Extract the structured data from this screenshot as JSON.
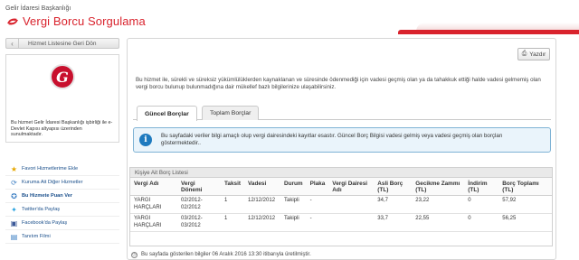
{
  "header": {
    "org_name": "Gelir İdaresi Başkanlığı",
    "app_title": "Vergi Borcu Sorgulama"
  },
  "sidebar": {
    "back_label": "Hizmet Listesine Geri Dön",
    "info_text": "Bu hizmet Gelir İdaresi Başkanlığı işbirliği ile e-Devlet Kapısı altyapısı üzerinden sunulmaktadır.",
    "links": [
      {
        "label": "Favori Hizmetlerime Ekle",
        "icon": "star-icon"
      },
      {
        "label": "Kuruma Ait Diğer Hizmetler",
        "icon": "refresh-icon"
      },
      {
        "label": "Bu Hizmete Puan Ver",
        "icon": "rating-icon"
      },
      {
        "label": "Twitter'da Paylaş",
        "icon": "twitter-icon"
      },
      {
        "label": "Facebook'da Paylaş",
        "icon": "facebook-icon"
      },
      {
        "label": "Tanıtım Filmi",
        "icon": "film-icon"
      }
    ]
  },
  "main": {
    "print_label": "Yazdır",
    "description": "Bu hizmet ile, sürekli ve süreksiz yükümlülüklerden kaynaklanan ve süresinde ödenmediği için vadesi geçmiş olan ya da tahakkuk ettiği halde vadesi gelmemiş olan vergi borcu bulunup bulunmadığına dair mükellef bazlı bilgilerinize ulaşabilirsiniz.",
    "tabs": [
      {
        "label": "Güncel Borçlar",
        "active": true
      },
      {
        "label": "Toplam Borçlar",
        "active": false
      }
    ],
    "alert": "Bu sayfadaki veriler bilgi amaçlı olup vergi dairesindeki kayıtlar esastır. Güncel Borç Bilgisi vadesi gelmiş veya vadesi geçmiş olan borçları göstermektedir..",
    "list_title": "Kişiye Ait Borç Listesi",
    "columns": [
      "Vergi Adı",
      "Vergi Dönemi",
      "Taksit",
      "Vadesi",
      "Durum",
      "Plaka",
      "Vergi Dairesi Adı",
      "Asli Borç (TL)",
      "Gecikme Zammı (TL)",
      "İndirim (TL)",
      "Borç Toplamı (TL)"
    ],
    "rows": [
      [
        "YARGI HARÇLARI",
        "02/2012-02/2012",
        "1",
        "12/12/2012",
        "Takipli",
        "-",
        "",
        "34,7",
        "23,22",
        "0",
        "57,92"
      ],
      [
        "YARGI HARÇLARI",
        "03/2012-03/2012",
        "1",
        "12/12/2012",
        "Takipli",
        "-",
        "",
        "33,7",
        "22,55",
        "0",
        "56,25"
      ]
    ],
    "footer_note": "Bu sayfada gösterilen bilgiler 06 Aralık 2016 13:30 itibarıyla üretilmiştir."
  },
  "colors": {
    "brand_red": "#d9232d",
    "link_blue": "#1a4f8b",
    "alert_blue": "#1e7abf"
  }
}
